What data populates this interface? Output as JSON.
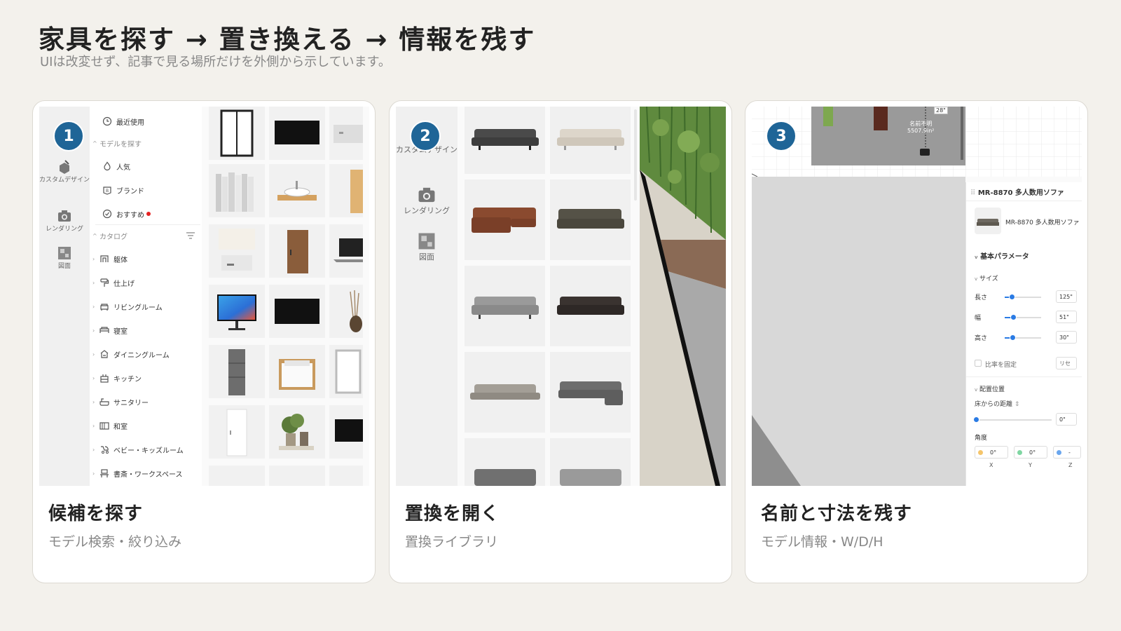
{
  "header": {
    "title": "家具を探す → 置き換える → 情報を残す",
    "subtitle": "UIは改変せず、記事で見る場所だけを外側から示しています。"
  },
  "colors": {
    "accent": "#1f6597",
    "background": "#f3f1ec",
    "slider": "#2a7be4"
  },
  "cards": [
    {
      "step": "1",
      "title": "候補を探す",
      "description": "モデル検索・絞り込み",
      "screenshot": {
        "rail": [
          {
            "label": "カスタムデザイン",
            "icon": "box-pencil-icon"
          },
          {
            "label": "レンダリング",
            "icon": "camera-icon"
          },
          {
            "label": "図面",
            "icon": "floorplan-icon"
          }
        ],
        "nav": {
          "recent": "最近使用",
          "model_search_header": "モデルを探す",
          "search_items": [
            "人気",
            "ブランド",
            "おすすめ"
          ],
          "catalog_header": "カタログ",
          "catalog_items": [
            "躯体",
            "仕上げ",
            "リビングルーム",
            "寝室",
            "ダイニングルーム",
            "キッチン",
            "サニタリー",
            "和室",
            "ベビー・キッズルーム",
            "書斎・ワークスペース"
          ]
        }
      }
    },
    {
      "step": "2",
      "title": "置換を開く",
      "description": "置換ライブラリ",
      "screenshot": {
        "rail": [
          {
            "label": "カスタムデザイン",
            "icon": "box-pencil-icon"
          },
          {
            "label": "レンダリング",
            "icon": "camera-icon"
          },
          {
            "label": "図面",
            "icon": "floorplan-icon"
          }
        ]
      }
    },
    {
      "step": "3",
      "title": "名前と寸法を残す",
      "description": "モデル情報・W/D/H",
      "screenshot": {
        "plan_label_1": "28\"",
        "plan_label_2": "名前不明",
        "plan_label_3": "5507.9in²",
        "panel": {
          "title": "MR-8870 多人数用ソファ",
          "model_name": "MR-8870 多人数用ソファ",
          "basic_params": "基本パラメータ",
          "size_header": "サイズ",
          "dimensions": [
            {
              "label": "長さ",
              "value": "125\"",
              "level": 0.2
            },
            {
              "label": "幅",
              "value": "51\"",
              "level": 0.24
            },
            {
              "label": "高さ",
              "value": "30\"",
              "level": 0.22
            }
          ],
          "lock_ratio": "比率を固定",
          "reset": "リセ",
          "placement_header": "配置位置",
          "floor_distance": "床からの距離",
          "floor_value": "0\"",
          "angle_label": "角度",
          "angles": [
            {
              "axis": "X",
              "value": "0°"
            },
            {
              "axis": "Y",
              "value": "0°"
            },
            {
              "axis": "Z",
              "value": "-"
            }
          ]
        }
      }
    }
  ]
}
